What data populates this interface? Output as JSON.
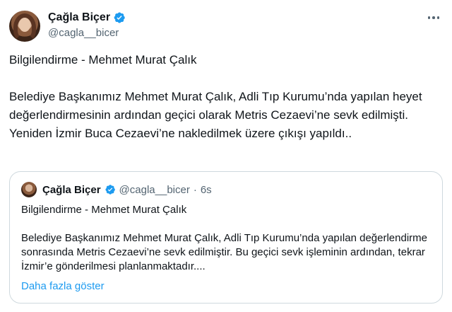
{
  "author": {
    "display_name": "Çağla Biçer",
    "handle": "@cagla__bicer"
  },
  "icons": {
    "verified": "verified-badge-icon",
    "more": "more-options-icon",
    "verified_color": "#1d9bf0"
  },
  "tweet": {
    "line1": "Bilgilendirme - Mehmet Murat Çalık",
    "line2": "Belediye Başkanımız Mehmet Murat Çalık, Adli Tıp Kurumu’nda yapılan heyet değerlendirmesinin ardından geçici olarak Metris Cezaevi’ne sevk edilmişti. Yeniden  İzmir Buca Cezaevi’ne nakledilmek üzere çıkışı yapıldı.."
  },
  "quote": {
    "display_name": "Çağla Biçer",
    "handle": "@cagla__bicer",
    "separator": "·",
    "time": "6s",
    "line1": "Bilgilendirme - Mehmet Murat Çalık",
    "line2": "Belediye Başkanımız Mehmet Murat Çalık, Adli Tıp Kurumu’nda yapılan değerlendirme sonrasında Metris Cezaevi’ne sevk edilmiştir. Bu geçici sevk işleminin ardından, tekrar İzmir’e gönderilmesi planlanmaktadır....",
    "show_more": "Daha fazla göster"
  }
}
